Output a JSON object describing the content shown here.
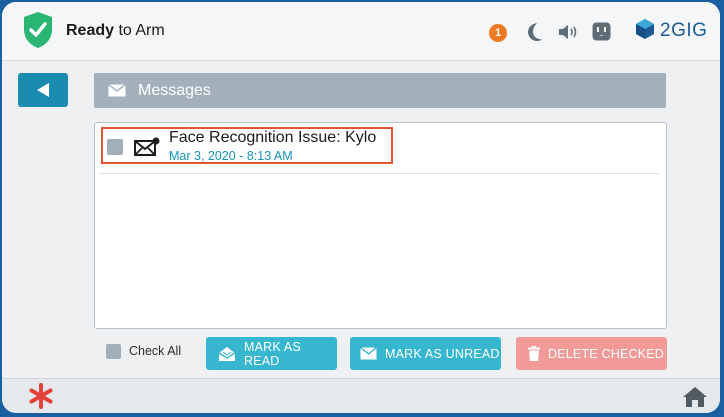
{
  "header": {
    "status_bold": "Ready",
    "status_rest": " to Arm",
    "notification_count": "1",
    "brand": "2GIG"
  },
  "page": {
    "title": "Messages"
  },
  "messages": [
    {
      "title": "Face Recognition Issue: Kylo",
      "date": "Mar 3, 2020 - 8:13 AM"
    }
  ],
  "actions": {
    "check_all": "Check All",
    "mark_as_read": "MARK AS READ",
    "mark_as_unread": "MARK AS UNREAD",
    "delete_checked": "DELETE CHECKED"
  },
  "colors": {
    "shield_green": "#2bb573",
    "accent_teal": "#37b6d0",
    "date_blue": "#1793b6",
    "delete_pink": "#f19a98",
    "highlight_red": "#e0542e",
    "notification_orange": "#ef7a24"
  }
}
